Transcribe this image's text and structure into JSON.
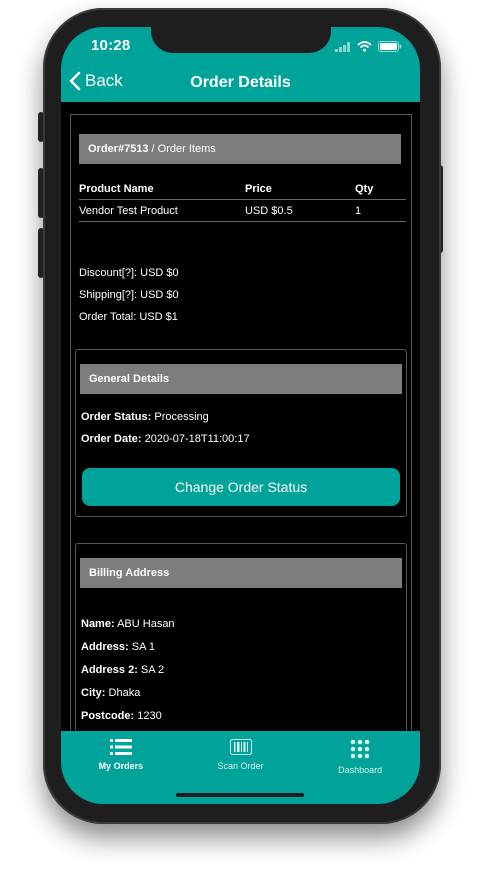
{
  "status_bar": {
    "time": "10:28"
  },
  "nav": {
    "back_label": "Back",
    "title": "Order Details"
  },
  "order_items": {
    "order_number": "Order#7513",
    "section_label": "/ Order Items",
    "columns": [
      "Product Name",
      "Price",
      "Qty"
    ],
    "rows": [
      {
        "product": "Vendor Test Product",
        "price": "USD $0.5",
        "qty": "1"
      }
    ]
  },
  "totals": {
    "discount": "Discount[?]: USD $0",
    "shipping": "Shipping[?]: USD $0",
    "order_total": "Order Total: USD $1"
  },
  "general_details": {
    "title": "General Details",
    "status_label": "Order Status:",
    "status_value": "Processing",
    "date_label": "Order Date:",
    "date_value": "2020-07-18T11:00:17",
    "change_button": "Change Order Status"
  },
  "billing": {
    "title": "Billing Address",
    "name_label": "Name:",
    "name_value": "ABU Hasan",
    "address_label": "Address:",
    "address_value": "SA 1",
    "address2_label": "Address 2:",
    "address2_value": "SA 2",
    "city_label": "City:",
    "city_value": "Dhaka",
    "postcode_label": "Postcode:",
    "postcode_value": "1230"
  },
  "tabs": [
    {
      "label": "My Orders",
      "icon": "list-icon",
      "active": true
    },
    {
      "label": "Scan Order",
      "icon": "barcode-icon",
      "active": false
    },
    {
      "label": "Dashboard",
      "icon": "grid-icon",
      "active": false
    }
  ],
  "colors": {
    "accent": "#00a39a",
    "header_gray": "#7d7d7d",
    "background": "#000000"
  }
}
